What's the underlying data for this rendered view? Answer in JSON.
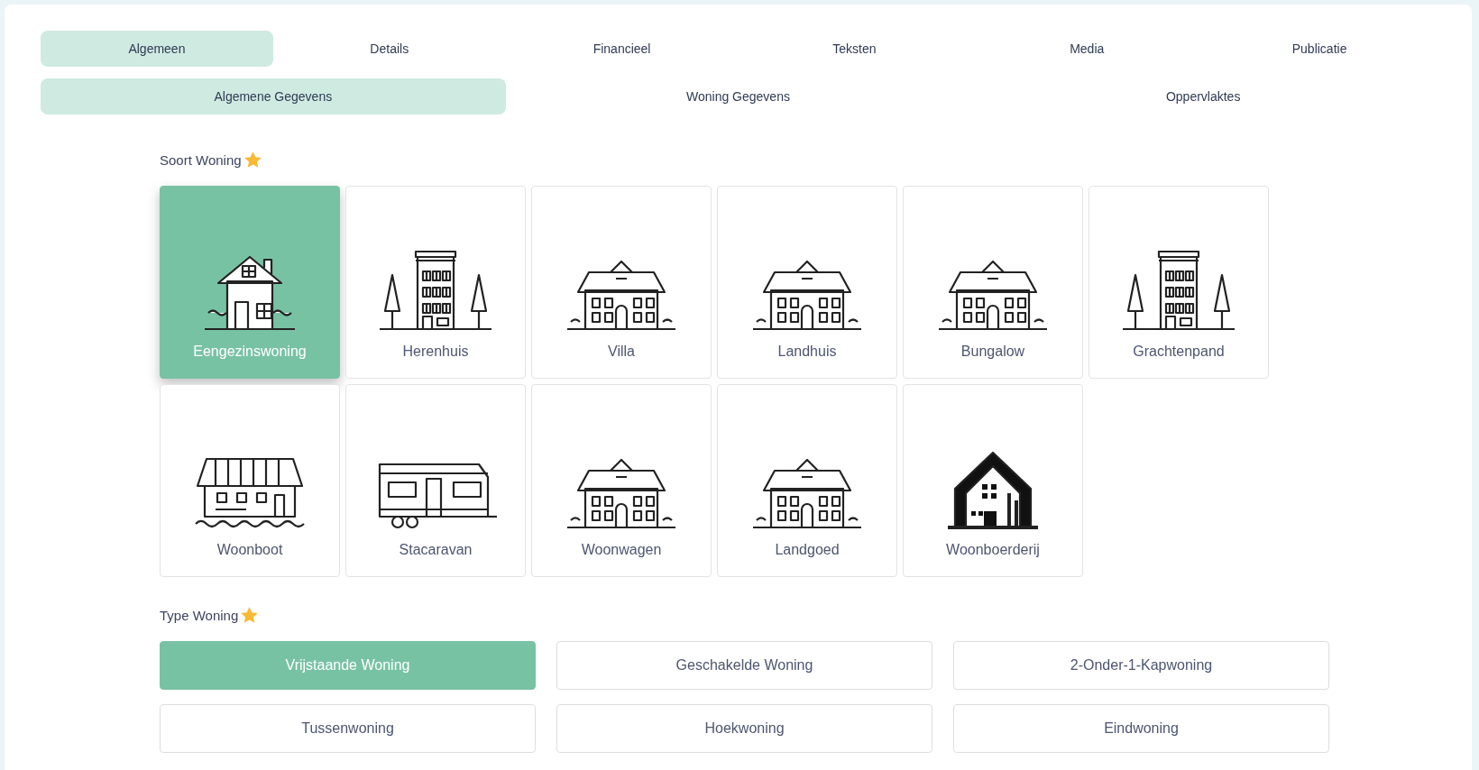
{
  "tabs": [
    {
      "label": "Algemeen",
      "selected": true
    },
    {
      "label": "Details",
      "selected": false
    },
    {
      "label": "Financieel",
      "selected": false
    },
    {
      "label": "Teksten",
      "selected": false
    },
    {
      "label": "Media",
      "selected": false
    },
    {
      "label": "Publicatie",
      "selected": false
    }
  ],
  "subtabs": [
    {
      "label": "Algemene Gegevens",
      "selected": true
    },
    {
      "label": "Woning Gegevens",
      "selected": false
    },
    {
      "label": "Oppervlaktes",
      "selected": false
    }
  ],
  "soort_woning": {
    "label": "Soort Woning",
    "required": true,
    "options": [
      {
        "label": "Eengezinswoning",
        "selected": true
      },
      {
        "label": "Herenhuis",
        "selected": false
      },
      {
        "label": "Villa",
        "selected": false
      },
      {
        "label": "Landhuis",
        "selected": false
      },
      {
        "label": "Bungalow",
        "selected": false
      },
      {
        "label": "Grachtenpand",
        "selected": false
      },
      {
        "label": "Woonboot",
        "selected": false
      },
      {
        "label": "Stacaravan",
        "selected": false
      },
      {
        "label": "Woonwagen",
        "selected": false
      },
      {
        "label": "Landgoed",
        "selected": false
      },
      {
        "label": "Woonboerderij",
        "selected": false
      }
    ]
  },
  "type_woning": {
    "label": "Type Woning",
    "required": true,
    "options": [
      {
        "label": "Vrijstaande Woning",
        "selected": true
      },
      {
        "label": "Geschakelde Woning",
        "selected": false
      },
      {
        "label": "2-Onder-1-Kapwoning",
        "selected": false
      },
      {
        "label": "Tussenwoning",
        "selected": false
      },
      {
        "label": "Hoekwoning",
        "selected": false
      },
      {
        "label": "Eindwoning",
        "selected": false
      }
    ]
  }
}
